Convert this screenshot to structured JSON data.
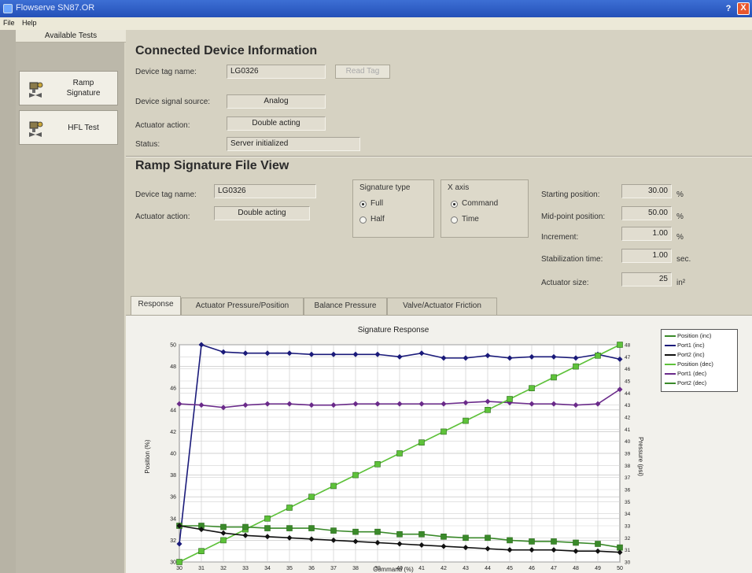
{
  "window": {
    "title": "Flowserve SN87.OR",
    "help": "?",
    "close": "X"
  },
  "menu": {
    "file": "File",
    "help": "Help"
  },
  "sidebar": {
    "header": "Available Tests",
    "tests": [
      {
        "label": "Ramp Signature"
      },
      {
        "label": "HFL Test"
      }
    ]
  },
  "connected": {
    "title": "Connected Device Information",
    "tag_label": "Device tag name:",
    "tag_value": "LG0326",
    "read_tag_button": "Read Tag",
    "source_label": "Device signal source:",
    "source_value": "Analog",
    "actuator_label": "Actuator action:",
    "actuator_value": "Double acting",
    "status_label": "Status:",
    "status_value": "Server initialized"
  },
  "ramp": {
    "title": "Ramp Signature File View",
    "tag_label": "Device tag name:",
    "tag_value": "LG0326",
    "actuator_label": "Actuator action:",
    "actuator_value": "Double acting",
    "signature_type_label": "Signature type",
    "sig_full": "Full",
    "sig_half": "Half",
    "xaxis_label": "X axis",
    "x_command": "Command",
    "x_time": "Time",
    "starting_label": "Starting position:",
    "starting_value": "30.00",
    "starting_unit": "%",
    "midpoint_label": "Mid-point position:",
    "midpoint_value": "50.00",
    "midpoint_unit": "%",
    "increment_label": "Increment:",
    "increment_value": "1.00",
    "increment_unit": "%",
    "stabilization_label": "Stabilization time:",
    "stabilization_value": "1.00",
    "stabilization_unit": "sec.",
    "actuator_size_label": "Actuator size:",
    "actuator_size_value": "25",
    "actuator_size_unit": "in²"
  },
  "tabs": [
    {
      "label": "Response"
    },
    {
      "label": "Actuator Pressure/Position"
    },
    {
      "label": "Balance Pressure"
    },
    {
      "label": "Valve/Actuator Friction"
    }
  ],
  "colors": {
    "navy": "#1a1a7a",
    "purple": "#6a2a8a",
    "black": "#111111",
    "green": "#5ec23a",
    "green_dark": "#3a8a2a"
  },
  "chart_data": {
    "type": "line",
    "title": "Signature Response",
    "xlabel": "Command (%)",
    "ylabel": "Position (%)",
    "ylabel_right": "Pressure (psi)",
    "x": [
      30,
      31,
      32,
      33,
      34,
      35,
      36,
      37,
      38,
      39,
      40,
      41,
      42,
      43,
      44,
      45,
      46,
      47,
      48,
      49,
      50
    ],
    "ylim": [
      30,
      50
    ],
    "ylim_right": [
      30,
      48
    ],
    "y_ticks": [
      30,
      32,
      34,
      36,
      38,
      40,
      42,
      44,
      46,
      48,
      50
    ],
    "y_ticks_right": [
      30,
      31,
      32,
      33,
      34,
      35,
      36,
      37,
      38,
      39,
      40,
      41,
      42,
      43,
      44,
      45,
      46,
      47,
      48
    ],
    "legend": [
      "Position (inc)",
      "Port1 (inc)",
      "Port2 (inc)",
      "Position (dec)",
      "Port1 (dec)",
      "Port2 (dec)"
    ],
    "legend_placement": "top-right",
    "grid": true,
    "series": [
      {
        "name": "Port1 (inc)",
        "axis": "right",
        "color": "#1a1a7a",
        "marker": "diamond",
        "values": [
          31.5,
          48.0,
          47.4,
          47.3,
          47.3,
          47.3,
          47.2,
          47.2,
          47.2,
          47.2,
          47.0,
          47.3,
          46.9,
          46.9,
          47.1,
          46.9,
          47.0,
          47.0,
          46.9,
          47.2,
          46.8
        ]
      },
      {
        "name": "Port1 (dec)",
        "axis": "right",
        "color": "#6a2a8a",
        "marker": "diamond",
        "values": [
          43.1,
          43.0,
          42.8,
          43.0,
          43.1,
          43.1,
          43.0,
          43.0,
          43.1,
          43.1,
          43.1,
          43.1,
          43.1,
          43.2,
          43.3,
          43.2,
          43.1,
          43.1,
          43.0,
          43.1,
          44.3
        ]
      },
      {
        "name": "Position (inc)",
        "axis": "left",
        "color": "#3a8a2a",
        "marker": "none",
        "values": [
          30,
          31,
          32,
          33,
          34,
          35,
          36,
          37,
          38,
          39,
          40,
          41,
          42,
          43,
          44,
          45,
          46,
          47,
          48,
          49,
          50
        ]
      },
      {
        "name": "Position (dec)",
        "axis": "left",
        "color": "#5ec23a",
        "marker": "square",
        "values": [
          30,
          31,
          32,
          33,
          34,
          35,
          36,
          37,
          38,
          39,
          40,
          41,
          42,
          43,
          44,
          45,
          46,
          47,
          48,
          49,
          50
        ]
      },
      {
        "name": "Port2 (dec)",
        "axis": "right",
        "color": "#3a8a2a",
        "marker": "square",
        "values": [
          33.0,
          33.0,
          32.9,
          32.9,
          32.8,
          32.8,
          32.8,
          32.6,
          32.5,
          32.5,
          32.3,
          32.3,
          32.1,
          32.0,
          32.0,
          31.8,
          31.7,
          31.7,
          31.6,
          31.5,
          31.2
        ]
      },
      {
        "name": "Port2 (inc)",
        "axis": "right",
        "color": "#111111",
        "marker": "diamond",
        "values": [
          33.0,
          32.7,
          32.4,
          32.2,
          32.1,
          32.0,
          31.9,
          31.8,
          31.7,
          31.6,
          31.5,
          31.4,
          31.3,
          31.2,
          31.1,
          31.0,
          31.0,
          31.0,
          30.9,
          30.9,
          30.8
        ]
      }
    ]
  }
}
